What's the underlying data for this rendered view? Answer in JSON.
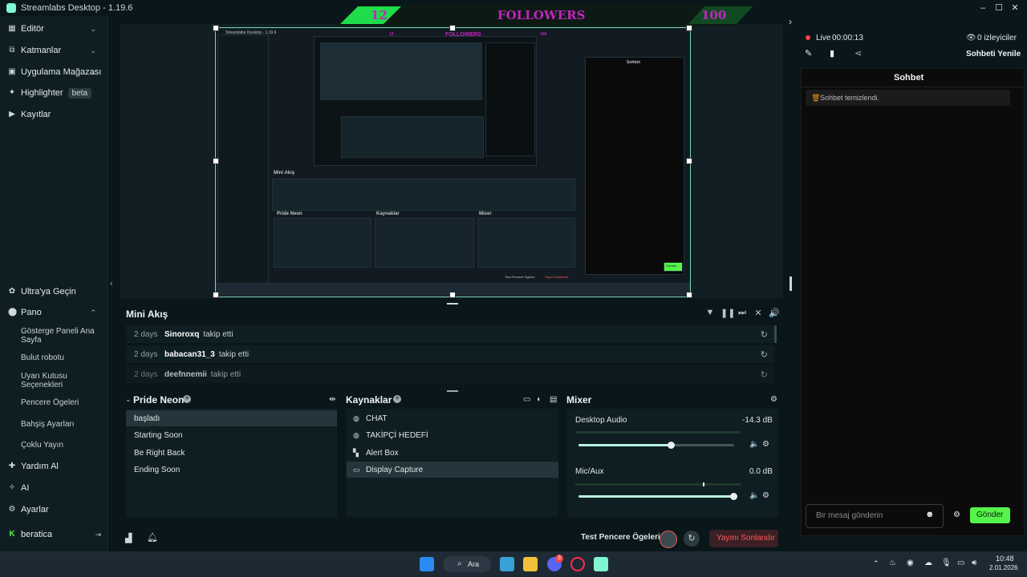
{
  "window": {
    "title": "Streamlabs Desktop - 1.19.6",
    "controls": [
      "–",
      "☐",
      "✕"
    ]
  },
  "sidebar": {
    "top_items": [
      {
        "label": "Editör",
        "icon": "editor-icon",
        "has_chevron": true
      },
      {
        "label": "Katmanlar",
        "icon": "layers-icon",
        "has_chevron": true
      },
      {
        "label": "Uygulama Mağazası",
        "icon": "store-icon",
        "has_chevron": true
      },
      {
        "label": "Highlighter",
        "icon": "highlighter-icon",
        "badge": "beta"
      },
      {
        "label": "Kayıtlar",
        "icon": "recordings-icon"
      }
    ],
    "ultra": "Ultra'ya Geçin",
    "pano": "Pano",
    "pano_sub": [
      "Gösterge Paneli Ana Sayfa",
      "Bulut robotu",
      "Uyarı Kutusu Seçenekleri",
      "Pencere Ögeleri",
      "Bahşiş Ayarları",
      "Çoklu Yayın"
    ],
    "bottom_items": [
      {
        "label": "Yardım Al",
        "icon": "help-icon"
      },
      {
        "label": "AI",
        "icon": "ai-icon"
      },
      {
        "label": "Ayarlar",
        "icon": "settings-icon"
      }
    ],
    "user": "beratica"
  },
  "banner": {
    "left": "12",
    "center": "FOLLOWERS",
    "right": "100"
  },
  "preview": {
    "inner_title": "Streamlabs Desktop - 1.19.6",
    "inner_banner_left": "12",
    "inner_banner_center": "FOLLOWERS",
    "inner_banner_right": "100",
    "inner_minifeed": "Mini Akış",
    "inner_scenes": "Pride Neon",
    "inner_sources": "Kaynaklar",
    "inner_mixer": "Mixer",
    "inner_chat": "Sohbet",
    "inner_send": "Gönder",
    "inner_end": "Yayını Sonlandır",
    "inner_test": "Test Pencere Ögeleri"
  },
  "minifeed": {
    "title": "Mini Akış",
    "rows": [
      {
        "days": "2 days",
        "name": "Sinoroxq",
        "action": "takip etti"
      },
      {
        "days": "2 days",
        "name": "babacan31_3",
        "action": "takip etti"
      },
      {
        "days": "2 days",
        "name": "deefnnemii",
        "action": "takip etti"
      }
    ]
  },
  "scenes": {
    "title": "Pride Neon",
    "items": [
      "başladı",
      "Starting Soon",
      "Be Right Back",
      "Ending Soon"
    ],
    "active_index": 0
  },
  "sources": {
    "title": "Kaynaklar",
    "items": [
      {
        "label": "CHAT",
        "icon": "globe-icon"
      },
      {
        "label": "TAKİPÇİ HEDEFİ",
        "icon": "globe-icon"
      },
      {
        "label": "Alert Box",
        "icon": "alert-box-icon"
      },
      {
        "label": "Display Capture",
        "icon": "monitor-icon"
      }
    ],
    "active_index": 3
  },
  "mixer": {
    "title": "Mixer",
    "channels": [
      {
        "name": "Desktop Audio",
        "db": "-14.3 dB",
        "level": 0.6
      },
      {
        "name": "Mic/Aux",
        "db": "0.0 dB",
        "level": 1.0
      }
    ]
  },
  "footer": {
    "test": "Test Pencere Ögeleri",
    "end": "Yayını Sonlandır"
  },
  "chat_header": {
    "live": "Live",
    "time": "00:00:13",
    "viewers": "0 izleyiciler",
    "refresh": "Sohbeti Yenile"
  },
  "chat": {
    "title": "Sohbet",
    "system_message": "Sohbet temizlendi.",
    "placeholder": "Bir mesaj gönderin",
    "send": "Gönder"
  },
  "taskbar": {
    "search": "Ara",
    "badge": "3",
    "time": "10:48",
    "date": "2.01.2026"
  },
  "colors": {
    "accent": "#80f5d2",
    "banner_text": "#c026c0",
    "banner_green": "#1fdc4a",
    "send_green": "#56f44a",
    "end_red": "#ff5a5a",
    "live_red": "#ff4545"
  }
}
